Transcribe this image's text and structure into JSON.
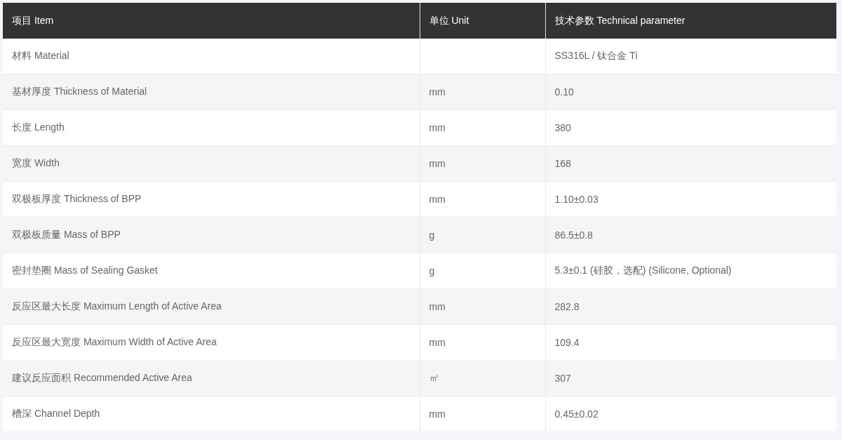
{
  "table": {
    "columns": [
      "项目 Item",
      "单位 Unit",
      "技术参数 Technical parameter"
    ],
    "rows": [
      [
        "材料 Material",
        "",
        "SS316L / 钛合金 Ti"
      ],
      [
        "基材厚度 Thickness of Material",
        "mm",
        "0.10"
      ],
      [
        "长度 Length",
        "mm",
        "380"
      ],
      [
        "宽度 Width",
        "mm",
        "168"
      ],
      [
        "双极板厚度 Thickness of BPP",
        "mm",
        "1.10±0.03"
      ],
      [
        "双极板质量 Mass of BPP",
        "g",
        "86.5±0.8"
      ],
      [
        "密封垫圈 Mass of Sealing Gasket",
        "g",
        "5.3±0.1 (硅胶，选配) (Silicone, Optional)"
      ],
      [
        "反应区最大长度 Maximum Length of Active Area",
        "mm",
        "282.8"
      ],
      [
        "反应区最大宽度 Maximum Width of Active Area",
        "mm",
        "109.4"
      ],
      [
        "建议反应面积 Recommended Active Area",
        "㎡",
        "307"
      ],
      [
        "槽深 Channel Depth",
        "mm",
        "0.45±0.02"
      ]
    ]
  }
}
